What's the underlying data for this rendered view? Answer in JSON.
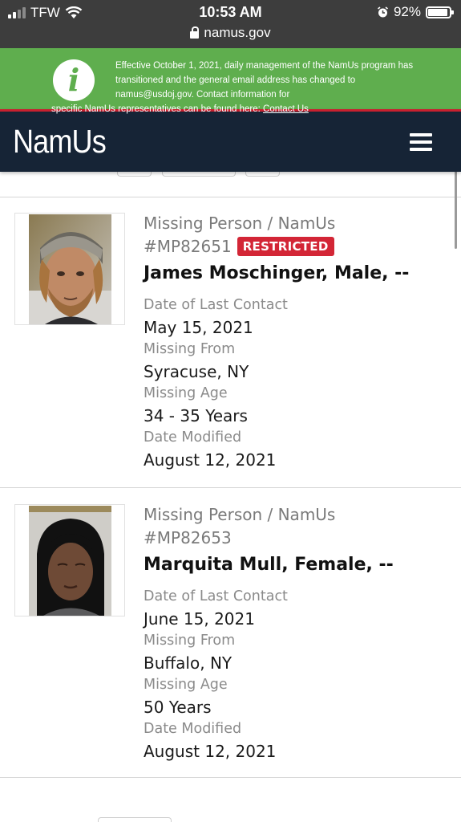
{
  "status_bar": {
    "carrier": "TFW",
    "time": "10:53 AM",
    "battery_percent": "92%",
    "battery_level": 0.92,
    "url": "namus.gov"
  },
  "notice": {
    "icon": "info-icon",
    "text": "Effective October 1, 2021, daily management of the NamUs program has transitioned and the general email address has changed to namus@usdoj.gov. Contact information for",
    "tail_text": "specific NamUs representatives can be found here:",
    "link_text": "Contact Us"
  },
  "header": {
    "logo": "NamUs",
    "menu_icon": "hamburger-menu-icon"
  },
  "results": [
    {
      "case_type": "Missing Person / NamUs",
      "case_number": "#MP82651",
      "badge": "RESTRICTED",
      "name": "James Moschinger, Male, --",
      "fields": [
        {
          "label": "Date of Last Contact",
          "value": "May 15, 2021"
        },
        {
          "label": "Missing From",
          "value": "Syracuse, NY"
        },
        {
          "label": "Missing Age",
          "value": "34 - 35 Years"
        },
        {
          "label": "Date Modified",
          "value": "August 12, 2021"
        }
      ]
    },
    {
      "case_type": "Missing Person / NamUs",
      "case_number": "#MP82653",
      "badge": "",
      "name": "Marquita Mull, Female, --",
      "fields": [
        {
          "label": "Date of Last Contact",
          "value": "June 15, 2021"
        },
        {
          "label": "Missing From",
          "value": "Buffalo, NY"
        },
        {
          "label": "Missing Age",
          "value": "50 Years"
        },
        {
          "label": "Date Modified",
          "value": "August 12, 2021"
        }
      ]
    }
  ],
  "colors": {
    "notice_green": "#5fae4e",
    "header_navy": "#162436",
    "accent_red": "#c8202f",
    "badge_red": "#d32636"
  }
}
